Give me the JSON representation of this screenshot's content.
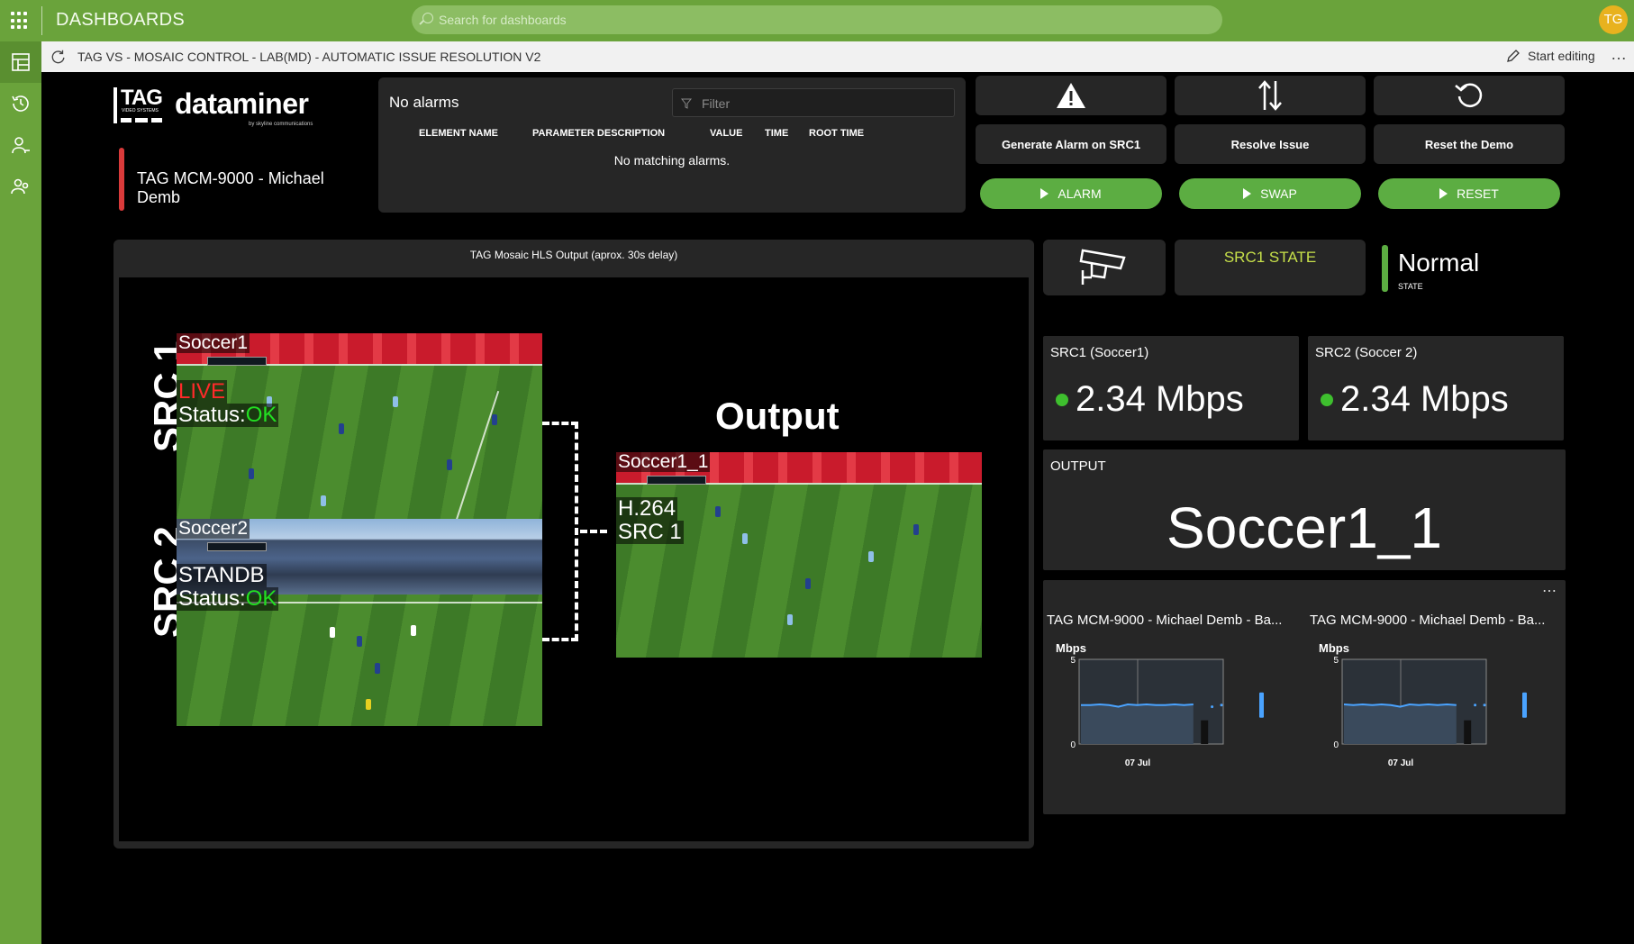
{
  "topbar": {
    "app_title": "DASHBOARDS",
    "search_placeholder": "Search for dashboards",
    "user_initials": "TG"
  },
  "breadcrumb": {
    "path": "TAG VS - MOSAIC CONTROL - LAB(MD) - AUTOMATIC ISSUE RESOLUTION V2",
    "edit_label": "Start editing",
    "more": "…"
  },
  "sidebar": {
    "items": [
      {
        "name": "dashboards-icon"
      },
      {
        "name": "history-icon"
      },
      {
        "name": "user-icon"
      },
      {
        "name": "users-icon"
      }
    ]
  },
  "logo": {
    "tag": "TAG",
    "tag_sub": "VIDEO SYSTEMS",
    "brand": "dataminer",
    "brand_sub": "by skyline communications"
  },
  "element": {
    "name": "TAG MCM-9000 - Michael Demb",
    "status_color": "#d93a3a"
  },
  "alarms": {
    "title": "No alarms",
    "filter_placeholder": "Filter",
    "columns": [
      "ELEMENT NAME",
      "PARAMETER DESCRIPTION",
      "VALUE",
      "TIME",
      "ROOT TIME"
    ],
    "empty_text": "No matching alarms."
  },
  "actions": [
    {
      "label": "Generate Alarm on SRC1",
      "icon": "warning-icon",
      "button": "ALARM"
    },
    {
      "label": "Resolve Issue",
      "icon": "swap-arrows-icon",
      "button": "SWAP"
    },
    {
      "label": "Reset the Demo",
      "icon": "reset-icon",
      "button": "RESET"
    }
  ],
  "video": {
    "caption": "TAG Mosaic HLS Output (aprox. 30s delay)",
    "src1_label": "SRC 1",
    "src2_label": "SRC 2",
    "output_label": "Output",
    "feed1": {
      "name": "Soccer1",
      "state": "LIVE",
      "status_prefix": "Status:",
      "status": "OK"
    },
    "feed2": {
      "name": "Soccer2",
      "state": "STANDB",
      "status_prefix": "Status:",
      "status": "OK"
    },
    "output": {
      "name": "Soccer1_1",
      "codec": "H.264",
      "source": "SRC 1"
    }
  },
  "state": {
    "icon": "camera-icon",
    "label": "SRC1 STATE",
    "value": "Normal",
    "sub": "STATE",
    "color": "#5cad42"
  },
  "kpis": {
    "src1": {
      "title": "SRC1 (Soccer1)",
      "value": "2.34 Mbps"
    },
    "src2": {
      "title": "SRC2 (Soccer 2)",
      "value": "2.34 Mbps"
    },
    "output": {
      "title": "OUTPUT",
      "value": "Soccer1_1"
    }
  },
  "trends": {
    "more": "⋯",
    "charts": [
      {
        "title": "TAG MCM-9000 - Michael Demb - Ba...",
        "unit": "Mbps",
        "y_ticks": [
          "5",
          "0"
        ],
        "x_tick": "07 Jul"
      },
      {
        "title": "TAG MCM-9000 - Michael Demb - Ba...",
        "unit": "Mbps",
        "y_ticks": [
          "5",
          "0"
        ],
        "x_tick": "07 Jul"
      }
    ]
  },
  "chart_data": [
    {
      "type": "area",
      "title": "TAG MCM-9000 - Michael Demb - Ba...",
      "ylabel": "Mbps",
      "ylim": [
        0,
        5
      ],
      "x_ticks": [
        "07 Jul"
      ],
      "series": [
        {
          "values": [
            2.3,
            2.3,
            2.34,
            2.3,
            2.2,
            2.34,
            2.3,
            2.34,
            2.3,
            2.3,
            2.34,
            2.3,
            2.34,
            2.3,
            2.2,
            2.3
          ]
        }
      ]
    },
    {
      "type": "area",
      "title": "TAG MCM-9000 - Michael Demb - Ba...",
      "ylabel": "Mbps",
      "ylim": [
        0,
        5
      ],
      "x_ticks": [
        "07 Jul"
      ],
      "series": [
        {
          "values": [
            2.34,
            2.3,
            2.34,
            2.3,
            2.34,
            2.3,
            2.2,
            2.34,
            2.3,
            2.34,
            2.3,
            2.34,
            2.3,
            2.34,
            2.3,
            2.3
          ]
        }
      ]
    }
  ]
}
